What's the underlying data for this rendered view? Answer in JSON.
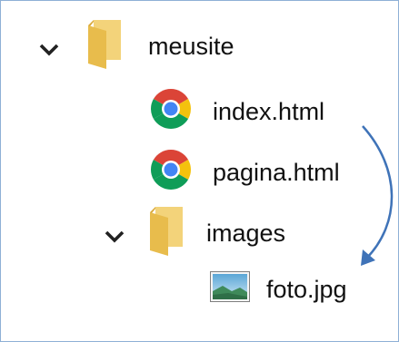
{
  "tree": {
    "root": {
      "label": "meusite",
      "expanded": true,
      "icon": "folder-icon"
    },
    "files": [
      {
        "label": "index.html",
        "icon": "chrome-icon"
      },
      {
        "label": "pagina.html",
        "icon": "chrome-icon"
      }
    ],
    "subfolder": {
      "label": "images",
      "expanded": true,
      "icon": "folder-icon",
      "files": [
        {
          "label": "foto.jpg",
          "icon": "image-file-icon"
        }
      ]
    }
  },
  "annotation": {
    "arrow_from": "index.html",
    "arrow_to": "foto.jpg",
    "color": "#3f73b8"
  }
}
